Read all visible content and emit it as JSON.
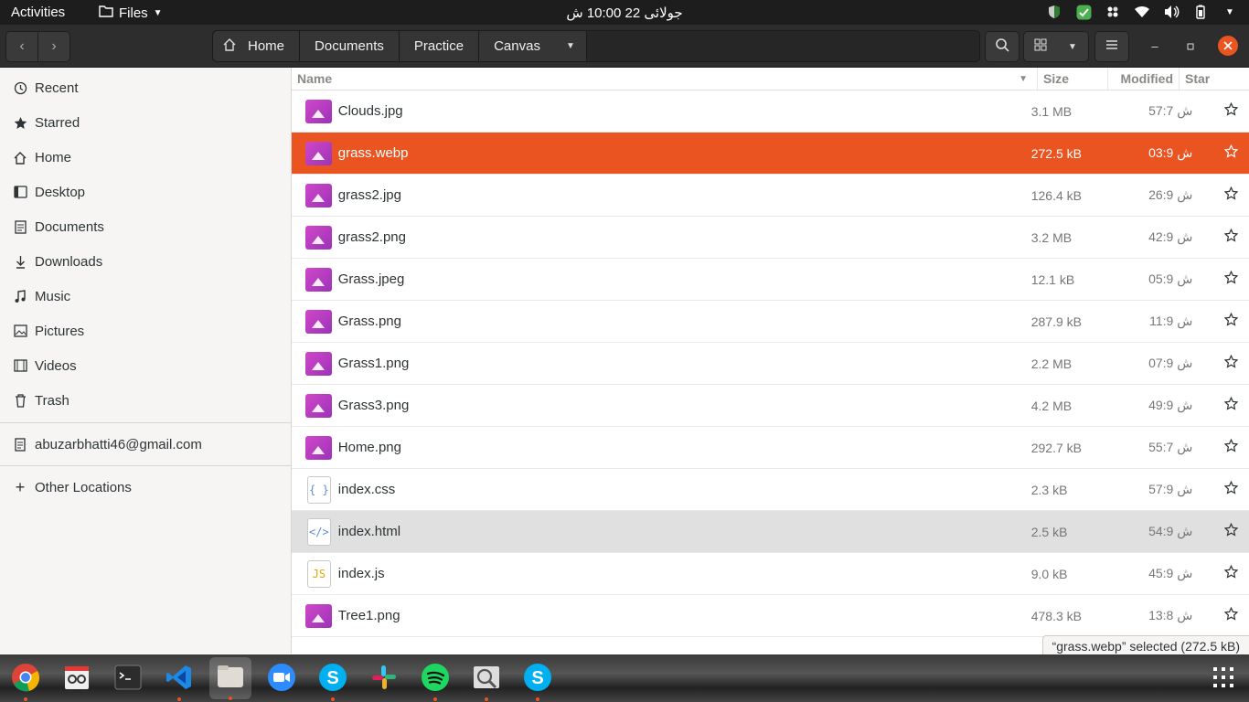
{
  "topbar": {
    "activities": "Activities",
    "app_menu": "Files",
    "clock": "جولائی 22  10:00 ش"
  },
  "path": [
    "Home",
    "Documents",
    "Practice",
    "Canvas"
  ],
  "sidebar": {
    "places": [
      {
        "label": "Recent",
        "icon": "clock-icon"
      },
      {
        "label": "Starred",
        "icon": "star-icon"
      },
      {
        "label": "Home",
        "icon": "home-icon"
      },
      {
        "label": "Desktop",
        "icon": "desktop-icon"
      },
      {
        "label": "Documents",
        "icon": "documents-icon"
      },
      {
        "label": "Downloads",
        "icon": "download-icon"
      },
      {
        "label": "Music",
        "icon": "music-icon"
      },
      {
        "label": "Pictures",
        "icon": "pictures-icon"
      },
      {
        "label": "Videos",
        "icon": "video-icon"
      },
      {
        "label": "Trash",
        "icon": "trash-icon"
      }
    ],
    "account": "abuzarbhatti46@gmail.com",
    "other_locations": "Other Locations"
  },
  "columns": {
    "name": "Name",
    "size": "Size",
    "modified": "Modified",
    "star": "Star"
  },
  "files": [
    {
      "name": "Clouds.jpg",
      "size": "3.1 MB",
      "modified": "57:7 ش",
      "type": "image"
    },
    {
      "name": "grass.webp",
      "size": "272.5 kB",
      "modified": "03:9 ش",
      "type": "image",
      "selected": true
    },
    {
      "name": "grass2.jpg",
      "size": "126.4 kB",
      "modified": "26:9 ش",
      "type": "image"
    },
    {
      "name": "grass2.png",
      "size": "3.2 MB",
      "modified": "42:9 ش",
      "type": "image"
    },
    {
      "name": "Grass.jpeg",
      "size": "12.1 kB",
      "modified": "05:9 ش",
      "type": "image"
    },
    {
      "name": "Grass.png",
      "size": "287.9 kB",
      "modified": "11:9 ش",
      "type": "image"
    },
    {
      "name": "Grass1.png",
      "size": "2.2 MB",
      "modified": "07:9 ش",
      "type": "image"
    },
    {
      "name": "Grass3.png",
      "size": "4.2 MB",
      "modified": "49:9 ش",
      "type": "image"
    },
    {
      "name": "Home.png",
      "size": "292.7 kB",
      "modified": "55:7 ش",
      "type": "image"
    },
    {
      "name": "index.css",
      "size": "2.3 kB",
      "modified": "57:9 ش",
      "type": "css"
    },
    {
      "name": "index.html",
      "size": "2.5 kB",
      "modified": "54:9 ش",
      "type": "html",
      "hover": true
    },
    {
      "name": "index.js",
      "size": "9.0 kB",
      "modified": "45:9 ش",
      "type": "js"
    },
    {
      "name": "Tree1.png",
      "size": "478.3 kB",
      "modified": "13:8 ش",
      "type": "image"
    }
  ],
  "status": "“grass.webp” selected  (272.5 kB)",
  "dock": [
    "chrome-icon",
    "text-editor-icon",
    "terminal-icon",
    "vscode-icon",
    "files-icon",
    "zoom-icon",
    "skype-icon",
    "slack-icon",
    "spotify-icon",
    "image-viewer-icon",
    "skype-icon",
    "app-grid-icon"
  ],
  "colors": {
    "accent": "#e95420",
    "image_icon": "#c142c3"
  }
}
